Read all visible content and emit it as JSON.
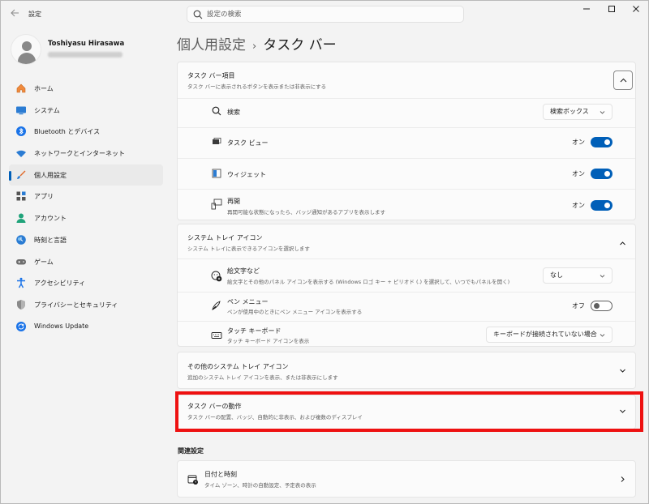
{
  "window": {
    "app_title": "設定",
    "search_placeholder": "設定の検索",
    "controls": {
      "minimize": "—",
      "maximize": "☐",
      "close": "✕"
    }
  },
  "profile": {
    "name": "Toshiyasu Hirasawa"
  },
  "sidebar": {
    "items": [
      {
        "label": "ホーム",
        "icon": "home-icon"
      },
      {
        "label": "システム",
        "icon": "system-icon"
      },
      {
        "label": "Bluetooth とデバイス",
        "icon": "bluetooth-icon"
      },
      {
        "label": "ネットワークとインターネット",
        "icon": "wifi-icon"
      },
      {
        "label": "個人用設定",
        "icon": "brush-icon",
        "active": true
      },
      {
        "label": "アプリ",
        "icon": "apps-icon"
      },
      {
        "label": "アカウント",
        "icon": "account-icon"
      },
      {
        "label": "時刻と言語",
        "icon": "time-language-icon"
      },
      {
        "label": "ゲーム",
        "icon": "gamepad-icon"
      },
      {
        "label": "アクセシビリティ",
        "icon": "accessibility-icon"
      },
      {
        "label": "プライバシーとセキュリティ",
        "icon": "shield-icon"
      },
      {
        "label": "Windows Update",
        "icon": "update-icon"
      }
    ]
  },
  "page": {
    "breadcrumb_parent": "個人用設定",
    "breadcrumb_sep": "›",
    "breadcrumb_current": "タスク バー"
  },
  "taskbar_items": {
    "title": "タスク バー項目",
    "subtitle": "タスク バーに表示されるボタンを表示または非表示にする",
    "rows": [
      {
        "label": "検索",
        "control": "dropdown",
        "value": "検索ボックス"
      },
      {
        "label": "タスク ビュー",
        "control": "toggle",
        "state": "オン"
      },
      {
        "label": "ウィジェット",
        "control": "toggle",
        "state": "オン"
      },
      {
        "label": "再開",
        "sub": "再開可能な状態になったら、バッジ通知があるアプリを表示します",
        "control": "toggle",
        "state": "オン"
      }
    ]
  },
  "tray_icons": {
    "title": "システム トレイ アイコン",
    "subtitle": "システム トレイに表示できるアイコンを選択します",
    "rows": [
      {
        "label": "絵文字など",
        "sub": "絵文字とその他のパネル アイコンを表示する (Windows ロゴ キー + ピリオド (.) を選択して、いつでもパネルを開く)",
        "control": "dropdown",
        "value": "なし"
      },
      {
        "label": "ペン メニュー",
        "sub": "ペンが使用中のときにペン メニュー アイコンを表示する",
        "control": "toggle",
        "state": "オフ"
      },
      {
        "label": "タッチ キーボード",
        "sub": "タッチ キーボード アイコンを表示",
        "control": "dropdown",
        "value": "キーボードが接続されていない場合"
      }
    ]
  },
  "other_tray": {
    "title": "その他のシステム トレイ アイコン",
    "subtitle": "追加のシステム トレイ アイコンを表示、または非表示にします"
  },
  "behaviors": {
    "title": "タスク バーの動作",
    "subtitle": "タスク バーの配置、バッジ、自動的に非表示、および複数のディスプレイ"
  },
  "related": {
    "heading": "関連設定",
    "items": [
      {
        "label": "日付と時刻",
        "sub": "タイム ゾーン、時計の自動設定、予定表の表示"
      }
    ]
  },
  "colors": {
    "accent": "#005fb8",
    "highlight_border": "#ee1111"
  }
}
